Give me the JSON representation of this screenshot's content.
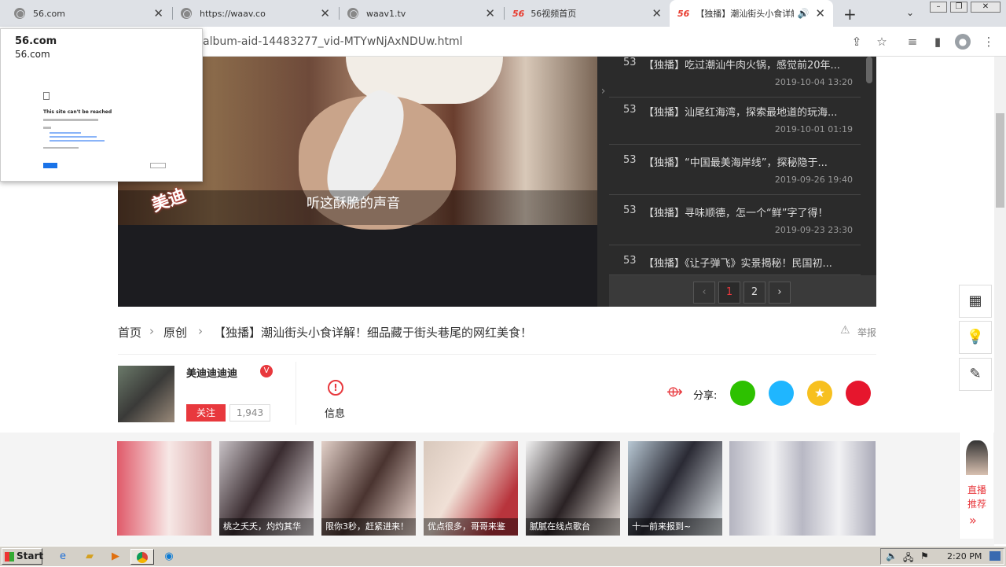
{
  "tabs": [
    {
      "title": "56.com",
      "favicon": "globe-icon"
    },
    {
      "title": "https://waav.co",
      "favicon": "globe-icon"
    },
    {
      "title": "waav1.tv",
      "favicon": "globe-icon"
    },
    {
      "title": "56视频首页",
      "favicon": "56-logo"
    },
    {
      "title": "【独播】潮汕街头小食详解",
      "favicon": "56-logo",
      "active": true
    }
  ],
  "favicon_text": "56",
  "address": {
    "url": "album-aid-14483277_vid-MTYwNjAxNDUw.html"
  },
  "popup": {
    "title": "56.com",
    "subtitle": "56.com",
    "error_title": "This site can't be reached"
  },
  "video": {
    "subtitle": "听这酥脆的声音",
    "watermark": "美迪"
  },
  "playlist": [
    {
      "num": "53",
      "title": "【独播】吃过潮汕牛肉火锅，感觉前20年...",
      "date": "2019-10-04 13:20"
    },
    {
      "num": "53",
      "title": "【独播】汕尾红海湾，探索最地道的玩海...",
      "date": "2019-10-01 01:19"
    },
    {
      "num": "53",
      "title": "【独播】“中国最美海岸线”，探秘隐于...",
      "date": "2019-09-26 19:40"
    },
    {
      "num": "53",
      "title": "【独播】寻味顺德，怎一个“鲜”字了得！",
      "date": "2019-09-23 23:30"
    },
    {
      "num": "53",
      "title": "【独播】《让子弹飞》实景揭秘！民国初...",
      "date": ""
    }
  ],
  "pagination": {
    "prev": "‹",
    "pages": [
      "1",
      "2"
    ],
    "next": "›",
    "current": "1"
  },
  "breadcrumb": {
    "home": "首页",
    "section": "原创",
    "title": "【独播】潮汕街头小食详解！细品藏于街头巷尾的网红美食！",
    "report": "举报"
  },
  "author": {
    "name": "美迪迪迪迪",
    "follow": "关注",
    "followers": "1,943",
    "info": "信息",
    "share_label": "分享:"
  },
  "thumbs": [
    {
      "caption": ""
    },
    {
      "caption": "桃之夭夭，灼灼其华"
    },
    {
      "caption": "限你3秒，赶紧进来！"
    },
    {
      "caption": "优点很多，哥哥来鉴"
    },
    {
      "caption": "腻腻在线点歌台"
    },
    {
      "caption": "十一前来报到~"
    },
    {
      "caption": ""
    }
  ],
  "side": {
    "live_line1": "直播",
    "live_line2": "推荐"
  },
  "taskbar": {
    "start": "Start",
    "time": "2:20 PM"
  },
  "colors": {
    "accent": "#e8383d",
    "wechat": "#2dc100",
    "qq": "#1fb6ff",
    "qzone": "#f7c01f",
    "weibo": "#e6162d"
  }
}
